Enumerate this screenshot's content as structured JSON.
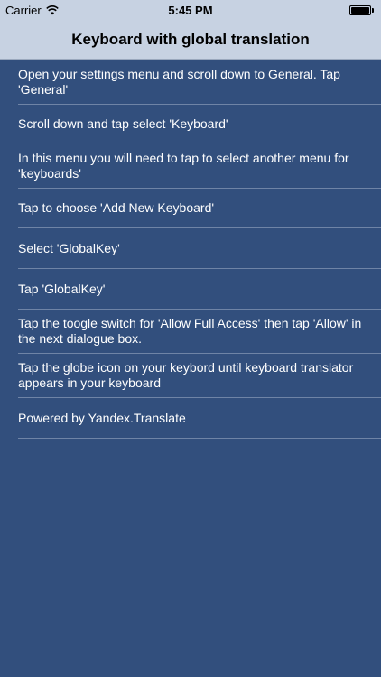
{
  "status_bar": {
    "carrier": "Carrier",
    "time": "5:45 PM"
  },
  "nav": {
    "title": "Keyboard with global translation"
  },
  "steps": [
    "Open your settings menu and scroll down to General. Tap 'General'",
    "Scroll down and tap select 'Keyboard'",
    "In this menu you will need to tap to select another menu for 'keyboards'",
    "Tap to choose 'Add New Keyboard'",
    "Select 'GlobalKey'",
    "Tap 'GlobalKey'",
    "Tap the toogle switch for 'Allow Full Access' then tap 'Allow' in the next dialogue box.",
    "Tap the globe icon on your keybord until keyboard translator appears in your keyboard",
    "Powered by Yandex.Translate"
  ],
  "colors": {
    "background": "#324f7d",
    "bar": "#c7d2e2",
    "separator": "#6f84a6"
  }
}
